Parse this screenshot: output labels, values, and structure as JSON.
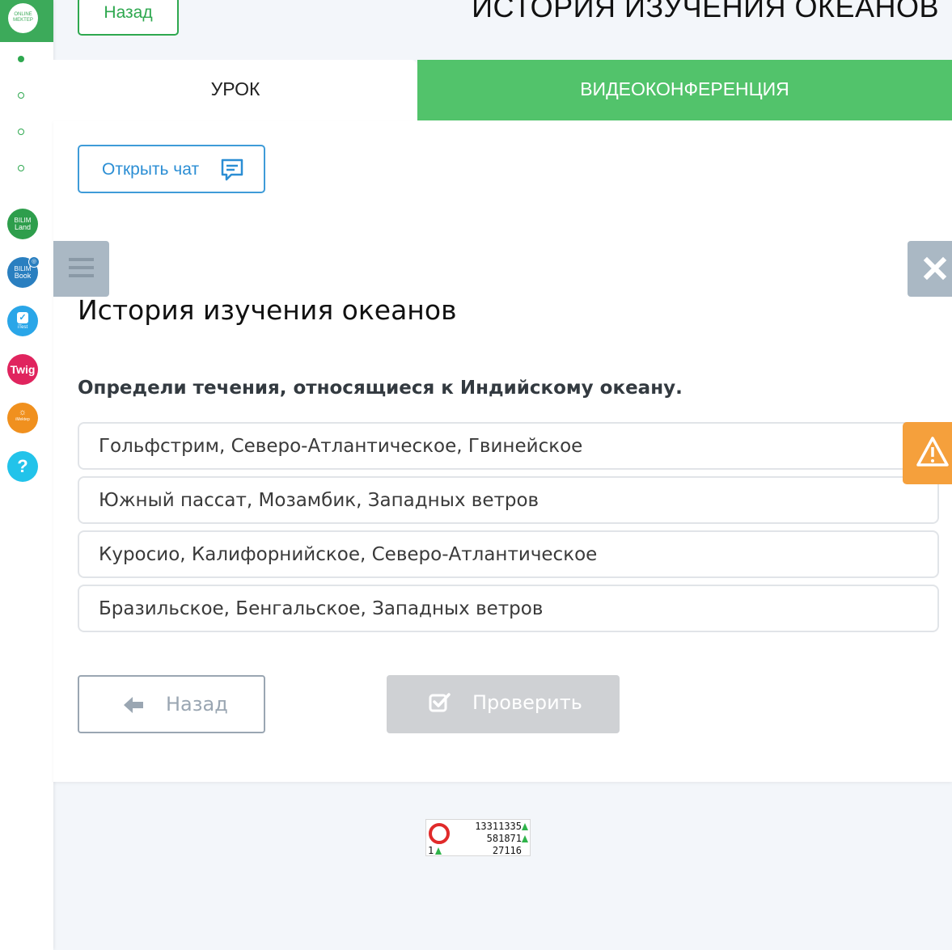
{
  "sidebar": {
    "logo_text": "ONLINE MEKTEP",
    "apps": [
      {
        "name": "BILIM Land",
        "icon": "bilimland-icon",
        "color": "#2e9e4c"
      },
      {
        "name": "BILIM Book",
        "icon": "bilimbook-icon",
        "color": "#2a7fc0"
      },
      {
        "name": "iTest",
        "icon": "itest-icon",
        "color": "#2aa6e8"
      },
      {
        "name": "Twig",
        "icon": "twig-icon",
        "color": "#e0245e"
      },
      {
        "name": "iMektep",
        "icon": "imektep-icon",
        "color": "#f0901e"
      },
      {
        "name": "?",
        "icon": "help-icon",
        "color": "#22c3ea"
      }
    ]
  },
  "header": {
    "back_label": "Назад",
    "title": "ИСТОРИЯ ИЗУЧЕНИЯ ОКЕАНОВ"
  },
  "tabs": {
    "lesson": "УРОК",
    "video": "ВИДЕОКОНФЕРЕНЦИЯ"
  },
  "main": {
    "chat_label": "Открыть чат",
    "lesson_title": "История изучения океанов",
    "question": "Определи течения, относящиеся к Индийскому океану.",
    "options": [
      "Гольфстрим, Северо-Атлантическое, Гвинейское",
      "Южный пассат, Мозамбик, Западных ветров",
      "Куросио, Калифорнийское, Северо-Атлантическое",
      "Бразильское, Бенгальское, Западных ветров"
    ],
    "back_label": "Назад",
    "check_label": "Проверить"
  },
  "counter": {
    "line1": "13311335",
    "line2": "581871",
    "line3": "27116",
    "line4": "1"
  },
  "colors": {
    "brand_green": "#52c36b",
    "chat_blue": "#2b8ed4",
    "warning_orange": "#f5a03c"
  }
}
